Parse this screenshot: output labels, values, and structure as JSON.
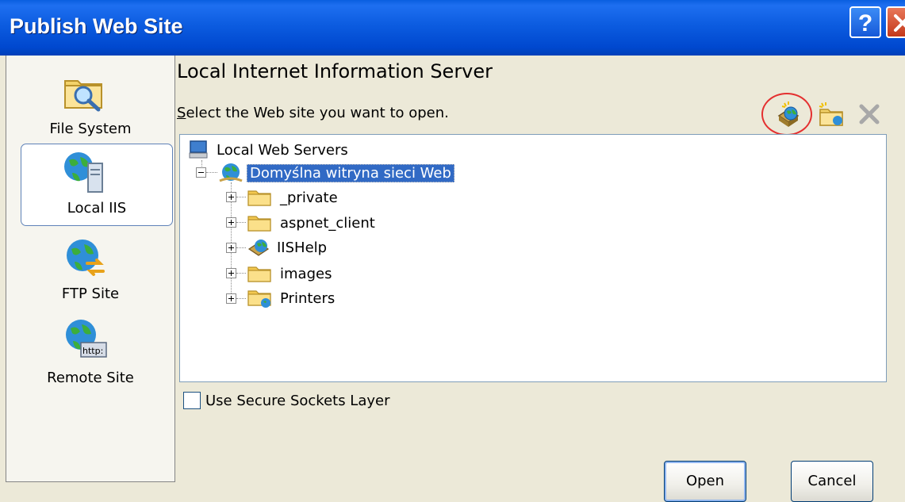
{
  "window": {
    "title": "Publish Web Site",
    "help_label": "?"
  },
  "sidebar": {
    "items": [
      {
        "label": "File System",
        "icon": "folder-search-icon"
      },
      {
        "label": "Local IIS",
        "icon": "local-iis-server-icon",
        "selected": true
      },
      {
        "label": "FTP Site",
        "icon": "ftp-globe-icon"
      },
      {
        "label": "Remote Site",
        "icon": "remote-http-globe-icon"
      }
    ]
  },
  "main": {
    "heading": "Local Internet Information Server",
    "prompt_first": "S",
    "prompt_rest": "elect the Web site you want to open.",
    "toolbar": [
      {
        "name": "create-new-web-site",
        "icon": "new-web-site-icon",
        "highlighted": true
      },
      {
        "name": "create-new-virtual-directory",
        "icon": "new-virtual-directory-icon"
      },
      {
        "name": "delete",
        "icon": "delete-x-icon",
        "disabled": true
      }
    ]
  },
  "tree": {
    "root": "Local Web Servers",
    "site": "Domyślna witryna sieci Web",
    "children": [
      {
        "label": "_private",
        "icon": "folder-icon"
      },
      {
        "label": "aspnet_client",
        "icon": "folder-icon"
      },
      {
        "label": "IISHelp",
        "icon": "web-app-icon"
      },
      {
        "label": "images",
        "icon": "folder-icon"
      },
      {
        "label": "Printers",
        "icon": "folder-globe-icon"
      }
    ]
  },
  "options": {
    "ssl_label": "Use Secure Sockets Layer",
    "ssl_checked": false
  },
  "buttons": {
    "open": "Open",
    "cancel": "Cancel"
  },
  "colors": {
    "titlebar": "#0a5fe0",
    "dialog_bg": "#ece9d8",
    "selection": "#316ac5",
    "highlight_circle": "#e43030"
  }
}
